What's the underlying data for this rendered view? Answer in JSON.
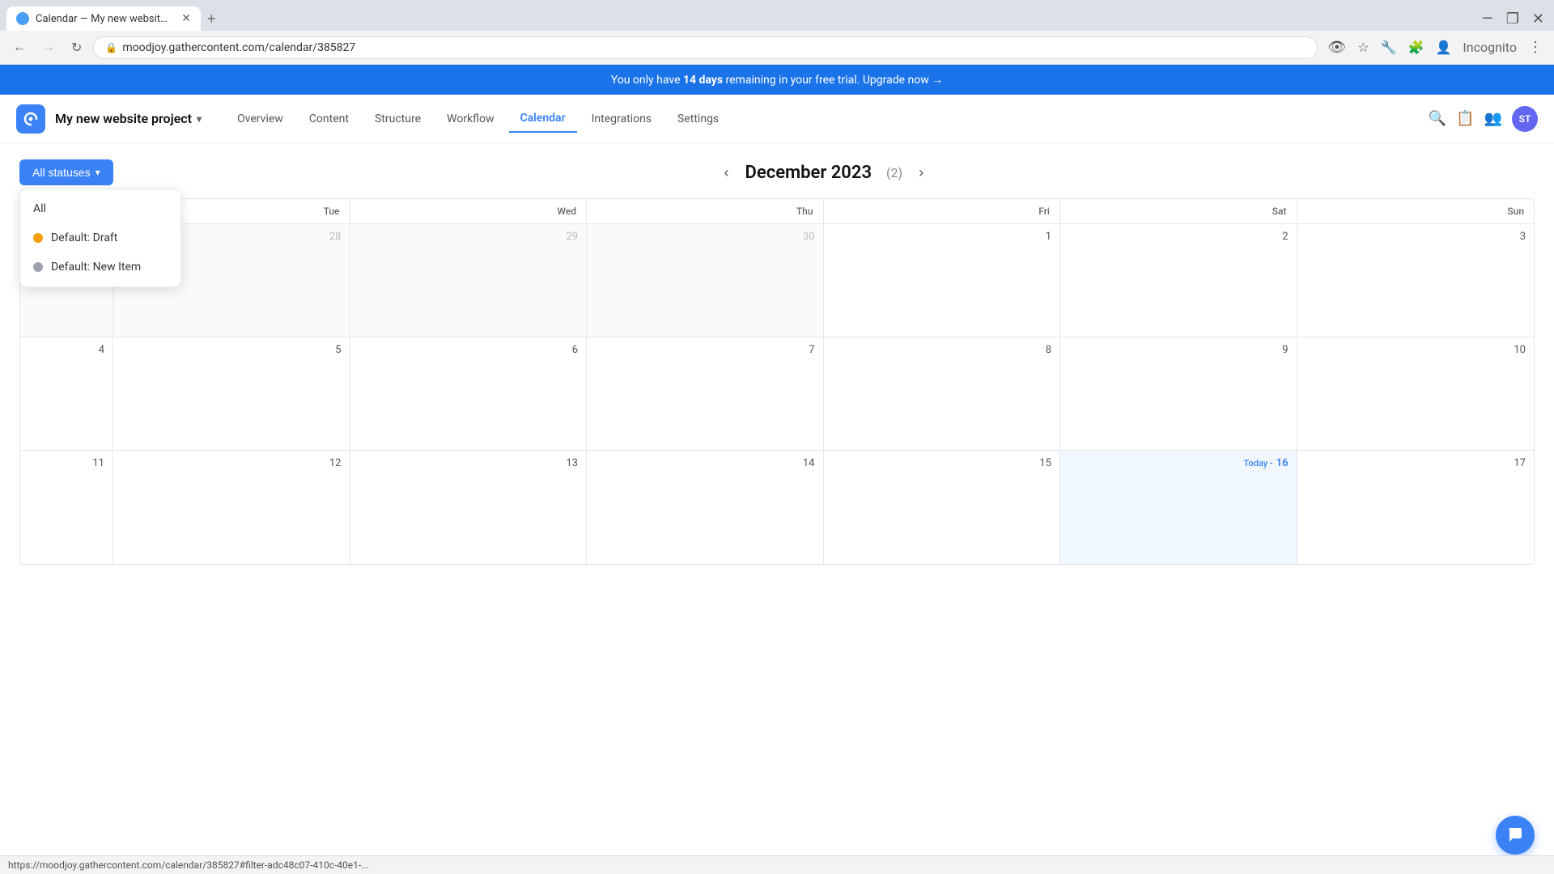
{
  "browser": {
    "tab_title": "Calendar — My new website p...",
    "url": "moodjoy.gathercontent.com/calendar/385827",
    "new_tab_label": "+",
    "back_btn": "←",
    "forward_btn": "→",
    "reload_btn": "↻",
    "incognito_label": "Incognito"
  },
  "banner": {
    "text_prefix": "You only have ",
    "highlight": "14 days",
    "text_suffix": " remaining in your free trial. Upgrade now →"
  },
  "header": {
    "project_name": "My new website project",
    "project_arrow": "▾",
    "nav_items": [
      {
        "label": "Overview",
        "active": false
      },
      {
        "label": "Content",
        "active": false
      },
      {
        "label": "Structure",
        "active": false
      },
      {
        "label": "Workflow",
        "active": false
      },
      {
        "label": "Calendar",
        "active": true
      },
      {
        "label": "Integrations",
        "active": false
      },
      {
        "label": "Settings",
        "active": false
      }
    ],
    "avatar_initials": "ST"
  },
  "calendar": {
    "filter_label": "All statuses",
    "month": "December 2023",
    "count": "(2)",
    "prev_arrow": "‹",
    "next_arrow": "›",
    "day_headers": [
      "Tue",
      "Wed",
      "Thu",
      "Fri",
      "Sat",
      "Sun"
    ],
    "weeks": [
      {
        "days": [
          {
            "number": "28",
            "outside": true
          },
          {
            "number": "29",
            "outside": true
          },
          {
            "number": "30",
            "outside": true
          },
          {
            "number": "1",
            "outside": false
          },
          {
            "number": "2",
            "outside": false
          },
          {
            "number": "3",
            "outside": false
          }
        ]
      },
      {
        "days": [
          {
            "number": "4",
            "outside": false
          },
          {
            "number": "5",
            "outside": false
          },
          {
            "number": "6",
            "outside": false
          },
          {
            "number": "7",
            "outside": false
          },
          {
            "number": "8",
            "outside": false
          },
          {
            "number": "9",
            "outside": false
          },
          {
            "number": "10",
            "outside": false
          }
        ]
      },
      {
        "days": [
          {
            "number": "11",
            "outside": false
          },
          {
            "number": "12",
            "outside": false
          },
          {
            "number": "13",
            "outside": false
          },
          {
            "number": "14",
            "outside": false
          },
          {
            "number": "15",
            "outside": false
          },
          {
            "number": "Today - 16",
            "outside": false,
            "today": true
          },
          {
            "number": "17",
            "outside": false
          }
        ]
      }
    ]
  },
  "dropdown": {
    "items": [
      {
        "label": "All",
        "dot": null
      },
      {
        "label": "Default: Draft",
        "dot": "orange"
      },
      {
        "label": "Default: New Item",
        "dot": "gray"
      }
    ]
  },
  "status_bar": {
    "url": "https://moodjoy.gathercontent.com/calendar/385827#filter-adc48c07-410c-40e1-..."
  }
}
